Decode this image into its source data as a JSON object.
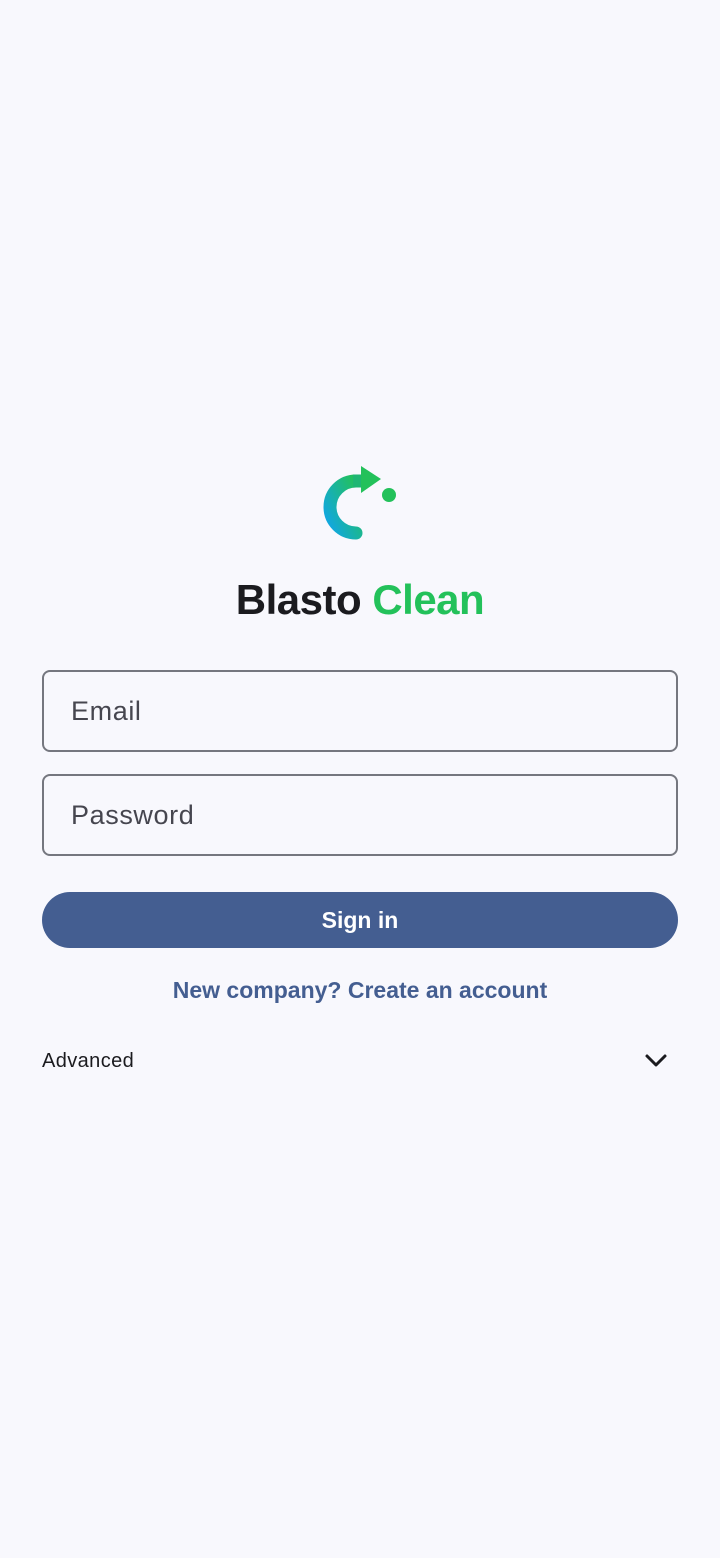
{
  "brand": {
    "name_part_1": "Blasto",
    "name_part_2": "Clean",
    "logo_icon": "brand-refresh-arrow-logo",
    "colors": {
      "dark": "#1b1b1f",
      "green": "#23c15a",
      "blue": "#10a6e6"
    }
  },
  "form": {
    "email_placeholder": "Email",
    "email_value": "",
    "password_placeholder": "Password",
    "password_value": "",
    "submit_label": "Sign in"
  },
  "links": {
    "create_account": "New company? Create an account"
  },
  "advanced": {
    "label": "Advanced",
    "icon": "chevron-down-icon",
    "expanded": false
  },
  "theme": {
    "background": "#f8f8fd",
    "primary": "#445e91",
    "outline": "#75777f"
  }
}
